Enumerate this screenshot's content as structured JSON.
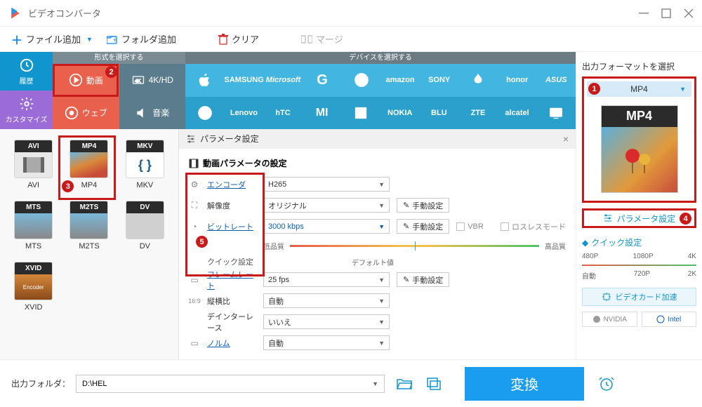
{
  "title": "ビデオコンバータ",
  "toolbar": {
    "add_file": "ファイル追加",
    "add_folder": "フォルダ追加",
    "clear": "クリア",
    "merge": "マージ"
  },
  "ribbon": {
    "history": "履歴",
    "customize": "カスタマイズ",
    "format_select": "形式を選択する",
    "device_select": "デバイスを選択する",
    "video": "動画",
    "hd": "4K/HD",
    "web": "ウェブ",
    "audio": "音楽",
    "brands_top": [
      "",
      "SAMSUNG",
      "Microsoft",
      "G",
      "",
      "amazon",
      "SONY",
      "",
      "honor",
      "ASUS"
    ],
    "brands_bot": [
      "",
      "Lenovo",
      "hTC",
      "",
      "",
      "NOKIA",
      "BLU",
      "ZTE",
      "alcatel",
      ""
    ]
  },
  "formats": [
    "AVI",
    "MP4",
    "MKV",
    "MTS",
    "M2TS",
    "DV",
    "XVID"
  ],
  "params": {
    "panel_title": "パラメータ設定",
    "section_title": "動画パラメータの設定",
    "encoder": "エンコーダ",
    "encoder_val": "H265",
    "resolution": "解像度",
    "resolution_val": "オリジナル",
    "bitrate": "ビットレート",
    "bitrate_val": "3000 kbps",
    "manual": "手動設定",
    "vbr": "VBR",
    "lossless": "ロスレスモード",
    "quick_setting": "クイック設定",
    "low_q": "低品質",
    "default_q": "デフォルト値",
    "high_q": "高品質",
    "framerate": "フレームレート",
    "framerate_val": "25 fps",
    "aspect": "縦横比",
    "aspect_val": "自動",
    "deinterlace": "デインターレース",
    "deinterlace_val": "いいえ",
    "norm": "ノルム",
    "norm_val": "自動"
  },
  "output": {
    "title": "出力フォーマットを選択",
    "selected": "MP4",
    "param_btn": "パラメータ設定",
    "quick_title": "クイック設定",
    "presets_top": [
      "480P",
      "1080P",
      "4K"
    ],
    "presets_bot": [
      "自動",
      "720P",
      "2K"
    ],
    "gpu": "ビデオカード加速",
    "nvidia": "NVIDIA",
    "intel": "Intel"
  },
  "bottom": {
    "label": "出力フォルダ：",
    "path": "D:\\HEL",
    "convert": "変換"
  }
}
